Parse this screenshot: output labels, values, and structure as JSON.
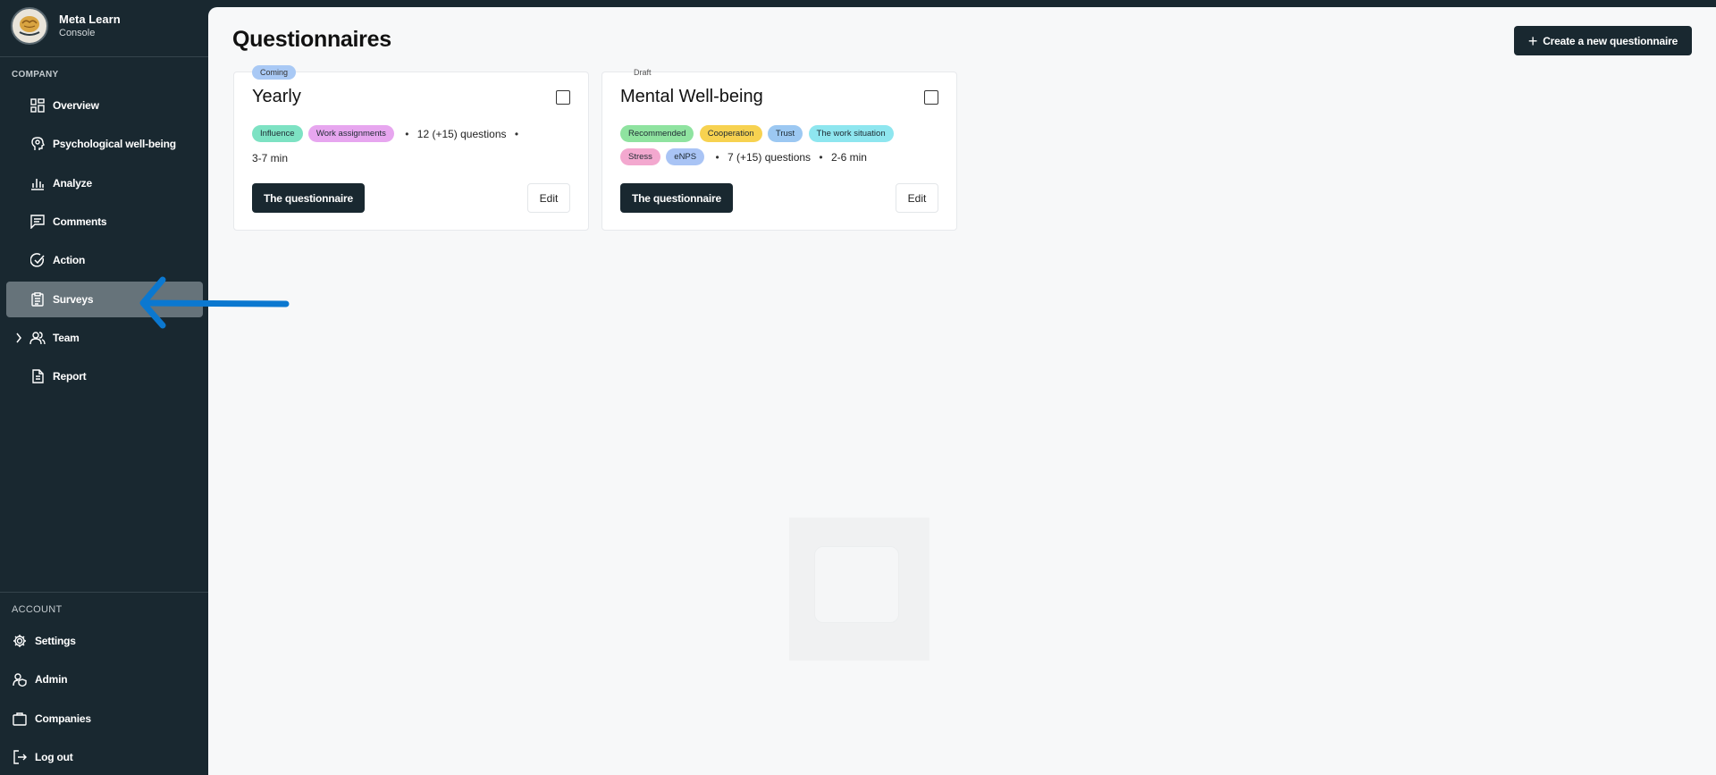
{
  "brand": {
    "title": "Meta Learn",
    "subtitle": "Console"
  },
  "sidebar": {
    "company_label": "COMPANY",
    "items": [
      {
        "label": "Overview",
        "icon": "grid-icon"
      },
      {
        "label": "Psychological well-being",
        "icon": "head-brain-icon"
      },
      {
        "label": "Analyze",
        "icon": "bar-chart-icon"
      },
      {
        "label": "Comments",
        "icon": "comment-icon"
      },
      {
        "label": "Action",
        "icon": "check-circle-icon"
      },
      {
        "label": "Surveys",
        "icon": "clipboard-icon",
        "active": true
      },
      {
        "label": "Team",
        "icon": "users-icon",
        "expandable": true
      },
      {
        "label": "Report",
        "icon": "document-icon"
      }
    ],
    "account_label": "ACCOUNT",
    "account_items": [
      {
        "label": "Settings",
        "icon": "gear-icon"
      },
      {
        "label": "Admin",
        "icon": "user-shield-icon"
      },
      {
        "label": "Companies",
        "icon": "briefcase-icon"
      },
      {
        "label": "Log out",
        "icon": "logout-icon"
      }
    ]
  },
  "main": {
    "title": "Questionnaires",
    "create_button": "Create a new questionnaire",
    "cards": [
      {
        "status": "Coming",
        "title": "Yearly",
        "tags": [
          {
            "label": "Influence",
            "color": "#7de2c3"
          },
          {
            "label": "Work assignments",
            "color": "#e7a6ef"
          }
        ],
        "questions": "12 (+15) questions",
        "duration": "3-7 min",
        "primary_button": "The questionnaire",
        "edit_button": "Edit"
      },
      {
        "status": "Draft",
        "title": "Mental Well-being",
        "tags": [
          {
            "label": "Recommended",
            "color": "#8fe3a0"
          },
          {
            "label": "Cooperation",
            "color": "#f7d250"
          },
          {
            "label": "Trust",
            "color": "#9cc8f2"
          },
          {
            "label": "The work situation",
            "color": "#8ee6ef"
          },
          {
            "label": "Stress",
            "color": "#f3a8cf"
          },
          {
            "label": "eNPS",
            "color": "#a9c4f5"
          }
        ],
        "questions": "7 (+15) questions",
        "duration": "2-6 min",
        "primary_button": "The questionnaire",
        "edit_button": "Edit"
      }
    ]
  },
  "colors": {
    "sidebar_bg": "#192830",
    "active_item_bg": "#66737a",
    "primary_button_bg": "#192830",
    "annotation_arrow": "#0b78d0",
    "status_coming": "#a9c9f5"
  }
}
